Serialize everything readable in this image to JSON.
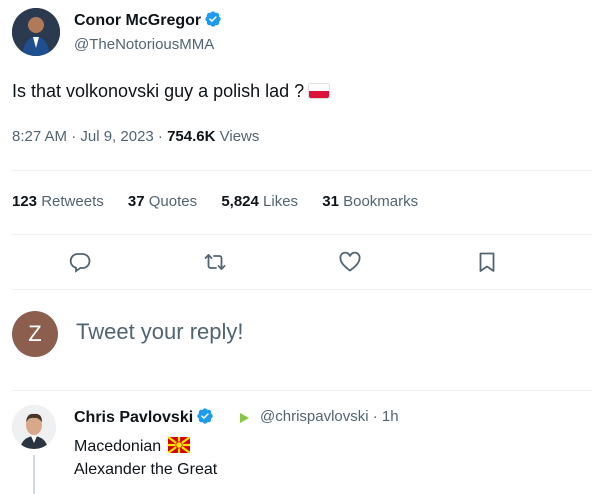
{
  "tweet": {
    "author_name": "Conor McGregor",
    "author_handle": "@TheNotoriousMMA",
    "text": "Is that volkonovski guy a polish lad ?",
    "flag_icon": "poland-flag-icon",
    "time": "8:27 AM · Jul 9, 2023 · ",
    "views_count": "754.6K",
    "views_label": " Views"
  },
  "stats": {
    "retweets_count": "123",
    "retweets_label": "Retweets",
    "quotes_count": "37",
    "quotes_label": "Quotes",
    "likes_count": "5,824",
    "likes_label": "Likes",
    "bookmarks_count": "31",
    "bookmarks_label": "Bookmarks"
  },
  "actions": [
    "reply-icon",
    "retweet-icon",
    "like-icon",
    "bookmark-icon"
  ],
  "composer": {
    "avatar_letter": "Z",
    "placeholder": "Tweet your reply!"
  },
  "reply": {
    "author_name": "Chris Pavlovski",
    "author_handle": "@chrispavlovski · 1h",
    "line1": "Macedonian",
    "line2": "Alexander the Great",
    "flag_icon": "north-macedonia-flag-icon"
  },
  "colors": {
    "verified": "#1d9bf0",
    "secondary_text": "#536471",
    "rumble_green": "#85c742"
  }
}
